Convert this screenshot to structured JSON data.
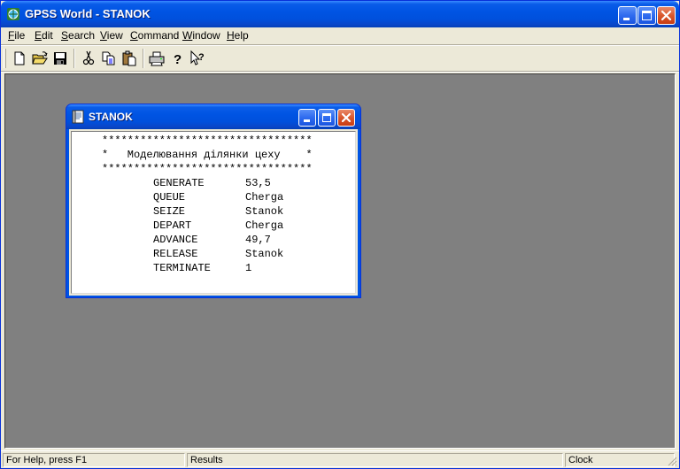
{
  "window": {
    "title": "GPSS World - STANOK",
    "icon": "gpss-world-icon"
  },
  "menu": [
    {
      "label": "File",
      "mnemonic": "F",
      "rest": "ile"
    },
    {
      "label": "Edit",
      "mnemonic": "E",
      "rest": "dit"
    },
    {
      "label": "Search",
      "mnemonic": "S",
      "rest": "earch"
    },
    {
      "label": "View",
      "mnemonic": "V",
      "rest": "iew"
    },
    {
      "label": "Command",
      "mnemonic": "C",
      "rest": "ommand"
    },
    {
      "label": "Window",
      "mnemonic": "W",
      "rest": "indow"
    },
    {
      "label": "Help",
      "mnemonic": "H",
      "rest": "elp"
    }
  ],
  "toolbar": {
    "buttons": [
      "new-file-icon",
      "open-folder-icon",
      "save-icon",
      "cut-icon",
      "copy-icon",
      "paste-icon",
      "print-icon",
      "help-icon",
      "context-help-icon"
    ]
  },
  "child": {
    "title": "STANOK",
    "lines": {
      "stars1": "*********************************",
      "comment": "*   Моделювання ділянки цеху    *",
      "stars2": "*********************************"
    },
    "code": [
      {
        "op": "GENERATE",
        "arg": "53,5"
      },
      {
        "op": "QUEUE",
        "arg": "Cherga"
      },
      {
        "op": "SEIZE",
        "arg": "Stanok"
      },
      {
        "op": "DEPART",
        "arg": "Cherga"
      },
      {
        "op": "ADVANCE",
        "arg": "49,7"
      },
      {
        "op": "RELEASE",
        "arg": "Stanok"
      },
      {
        "op": "TERMINATE",
        "arg": "1"
      }
    ]
  },
  "status": {
    "help": "For Help, press F1",
    "results": "Results",
    "clock": "Clock"
  },
  "colors": {
    "titlebar": "#0054e3",
    "close_button": "#c73c12",
    "client_bg": "#808080",
    "chrome": "#ece9d8"
  }
}
